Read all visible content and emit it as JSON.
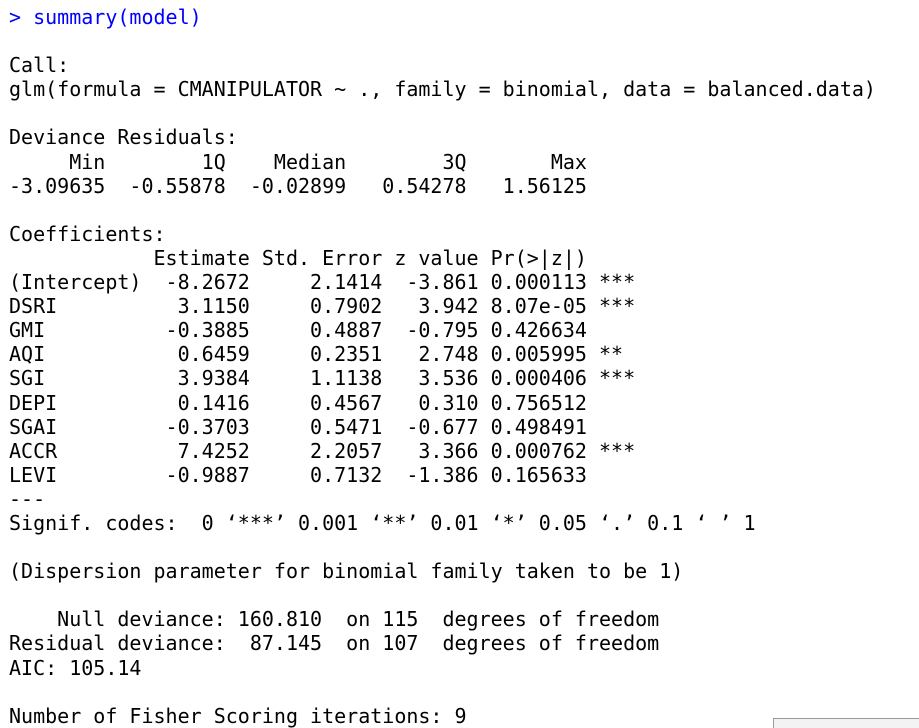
{
  "command": "> summary(model)",
  "call_label": "Call:",
  "call_formula": "glm(formula = CMANIPULATOR ~ ., family = binomial, data = balanced.data)",
  "deviance_residuals": {
    "title": "Deviance Residuals:",
    "header": "     Min        1Q    Median        3Q       Max  ",
    "values": "-3.09635  -0.55878  -0.02899   0.54278   1.56125  "
  },
  "coefficients": {
    "title": "Coefficients:",
    "header": "            Estimate Std. Error z value Pr(>|z|)    ",
    "rows": [
      "(Intercept)  -8.2672     2.1414  -3.861 0.000113 ***",
      "DSRI          3.1150     0.7902   3.942 8.07e-05 ***",
      "GMI          -0.3885     0.4887  -0.795 0.426634    ",
      "AQI           0.6459     0.2351   2.748 0.005995 ** ",
      "SGI           3.9384     1.1138   3.536 0.000406 ***",
      "DEPI          0.1416     0.4567   0.310 0.756512    ",
      "SGAI         -0.3703     0.5471  -0.677 0.498491    ",
      "ACCR          7.4252     2.2057   3.366 0.000762 ***",
      "LEVI         -0.9887     0.7132  -1.386 0.165633    "
    ],
    "separator": "---",
    "signif_codes": "Signif. codes:  0 ‘***’ 0.001 ‘**’ 0.01 ‘*’ 0.05 ‘.’ 0.1 ‘ ’ 1"
  },
  "dispersion": "(Dispersion parameter for binomial family taken to be 1)",
  "null_deviance": "    Null deviance: 160.810  on 115  degrees of freedom",
  "residual_deviance": "Residual deviance:  87.145  on 107  degrees of freedom",
  "aic": "AIC: 105.14",
  "fisher_iterations": "Number of Fisher Scoring iterations: 9",
  "colors": {
    "command": "#0000ff",
    "output": "#000000",
    "background": "#ffffff"
  }
}
